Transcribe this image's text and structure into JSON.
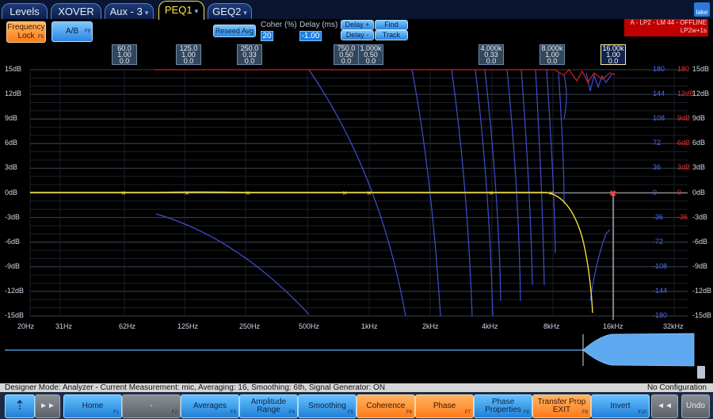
{
  "tabs": [
    {
      "label": "Levels"
    },
    {
      "label": "XOVER"
    },
    {
      "label": "Aux - 3"
    },
    {
      "label": "PEQ1"
    },
    {
      "label": "GEQ2"
    }
  ],
  "logo": "lake",
  "controls": {
    "frequency_lock": "Frequency Lock",
    "frequency_lock_key": "F5",
    "ab": "A/B",
    "ab_key": "F9",
    "reseed": "Reseed Avg",
    "coher_label": "Coher (%)",
    "coher_value": "20",
    "delay_label": "Delay (ms)",
    "delay_value": "-1.00",
    "delay_plus": "Delay +",
    "delay_minus": "Delay -",
    "find": "Find",
    "track": "Track"
  },
  "offline": {
    "line1": "A - LP2 - LM 44 - OFFLINE",
    "line2": "LP2w+1s"
  },
  "bands": [
    {
      "freq": "60.0",
      "gain": "1.00",
      "q": "0.0"
    },
    {
      "freq": "125.0",
      "gain": "1.00",
      "q": "0.0"
    },
    {
      "freq": "250.0",
      "gain": "0.33",
      "q": "0.0"
    },
    {
      "freq": "750.0",
      "gain": "0.50",
      "q": "0.0"
    },
    {
      "freq": "1.000k",
      "gain": "0.50",
      "q": "0.0"
    },
    {
      "freq": "4.000k",
      "gain": "0.33",
      "q": "0.0"
    },
    {
      "freq": "8.000k",
      "gain": "1.00",
      "q": "0.0"
    },
    {
      "freq": "16.00k",
      "gain": "1.00",
      "q": "0.0"
    }
  ],
  "y_left": [
    "15dB",
    "12dB",
    "9dB",
    "6dB",
    "3dB",
    "0dB",
    "-3dB",
    "-6dB",
    "-9dB",
    "-12dB",
    "-15dB"
  ],
  "y_right": [
    "15dB",
    "12dB",
    "9dB",
    "6dB",
    "3dB",
    "0dB",
    "-3dB",
    "-6dB",
    "-9dB",
    "-12dB",
    "-15dB"
  ],
  "y_phase_blue": [
    "180",
    "144",
    "108",
    "72",
    "36",
    "0",
    "-36",
    "-72",
    "-108",
    "-144",
    "-180"
  ],
  "y_phase_red": [
    "180",
    "12dB",
    "9dB",
    "6dB",
    "3dB",
    "0",
    "-36",
    "",
    "",
    "",
    ""
  ],
  "x_labels": [
    "20Hz",
    "31Hz",
    "62Hz",
    "125Hz",
    "250Hz",
    "500Hz",
    "1kHz",
    "2kHz",
    "4kHz",
    "8kHz",
    "16kHz",
    "32kHz"
  ],
  "colors": {
    "magnitude": "#f0e040",
    "phase": "#3f4fd0",
    "coherence": "#d02020",
    "grid": "#3a3f4a"
  },
  "status": {
    "left": "Designer Mode: Analyzer - Current Measurement: mic, Averaging: 16, Smoothing: 6th, Signal Generator: ON",
    "right": "No Configuration"
  },
  "toolbar": {
    "home": "Home",
    "home_key": "F1",
    "dash": "-",
    "dash_key": "F2",
    "averages": "Averages",
    "averages_key": "F3",
    "amplitude": "Amplitude Range",
    "amplitude_key": "F4",
    "smoothing": "Smoothing",
    "smoothing_key": "F5",
    "coherence": "Coherence",
    "coherence_key": "F6",
    "phase": "Phase",
    "phase_key": "F7",
    "phase_props": "Phase Properties",
    "phase_props_key": "F8",
    "transfer": "Transfer Prop EXIT",
    "transfer_key": "F9",
    "invert": "Invert",
    "invert_key": "F10",
    "undo": "Undo"
  }
}
